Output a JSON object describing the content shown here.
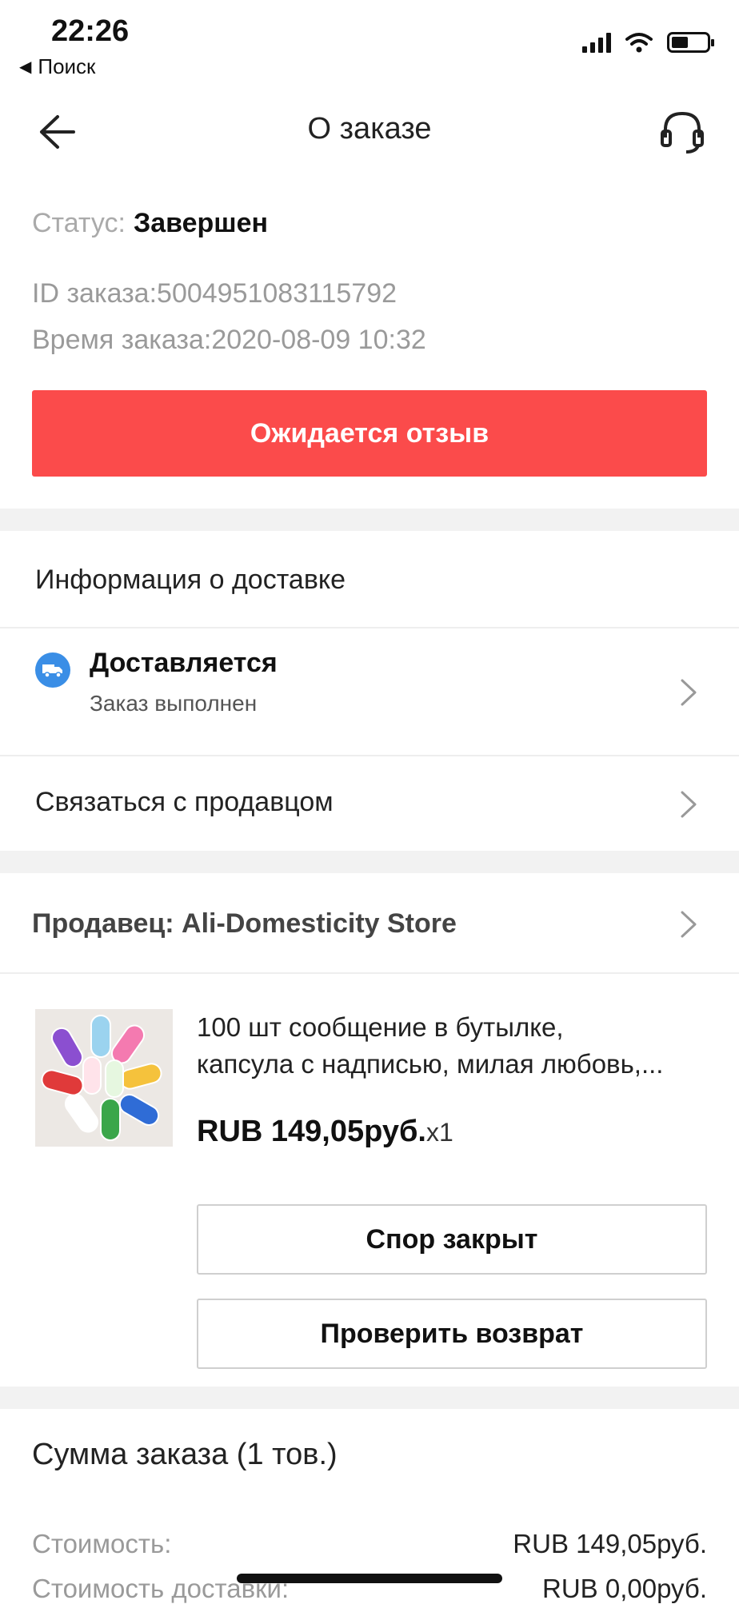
{
  "status_bar": {
    "time": "22:26",
    "back_app": "Поиск"
  },
  "header": {
    "title": "О заказе"
  },
  "order": {
    "status_label": "Статус:",
    "status_value": "Завершен",
    "id_line": "ID заказа:5004951083115792",
    "time_line": "Время заказа:2020-08-09 10:32",
    "review_button": "Ожидается отзыв"
  },
  "delivery": {
    "section_title": "Информация о доставке",
    "status_title": "Доставляется",
    "status_sub": "Заказ выполнен",
    "contact_seller": "Связаться с продавцом"
  },
  "seller": {
    "label": "Продавец: Ali-Domesticity Store"
  },
  "product": {
    "title_line1": "100 шт сообщение в бутылке,",
    "title_line2": "капсула с надписью, милая любовь,...",
    "price": "RUB 149,05руб.",
    "qty": "x1",
    "dispute_button": "Спор закрыт",
    "return_button": "Проверить возврат"
  },
  "summary": {
    "title": "Сумма заказа (1 тов.)",
    "cost_label": "Стоимость:",
    "cost_value": "RUB 149,05руб.",
    "shipping_label": "Стоимость доставки:",
    "shipping_value": "RUB 0,00руб."
  },
  "colors": {
    "accent": "#fb4b4b",
    "truck": "#3a8ee6"
  }
}
